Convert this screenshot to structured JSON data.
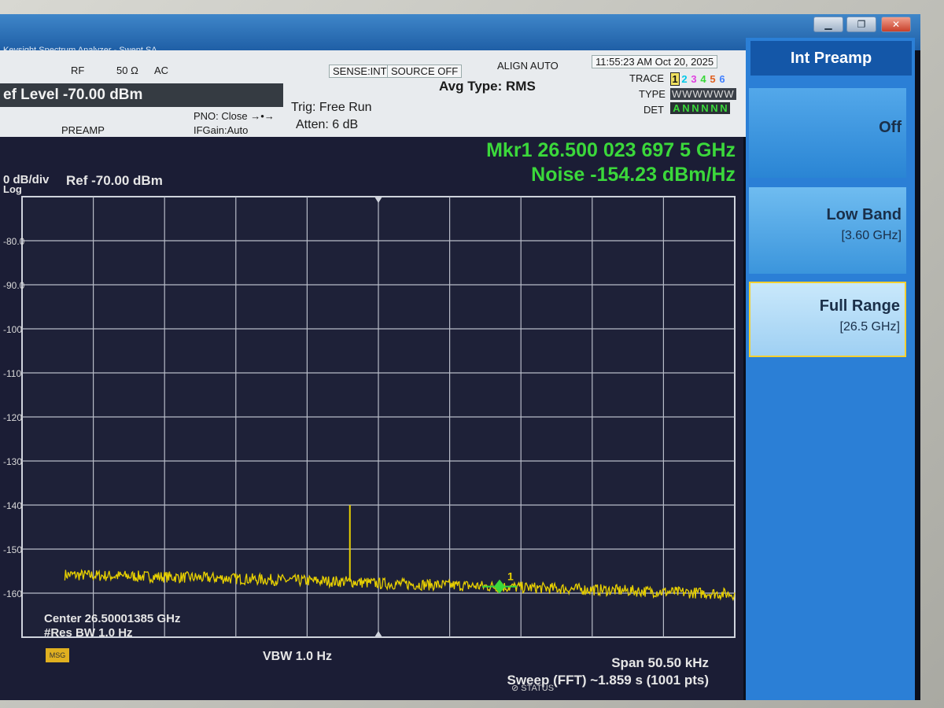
{
  "window": {
    "title": "Keysight Spectrum Analyzer - Swept SA"
  },
  "status": {
    "rf": "RF",
    "impedance": "50 Ω",
    "coupling": "AC",
    "sense": "SENSE:INT",
    "source": "SOURCE OFF",
    "align": "ALIGN AUTO",
    "datetime": "11:55:23 AM Oct 20, 2025",
    "ref_level": "ef Level -70.00 dBm",
    "preamp": "PREAMP",
    "pno": "PNO: Close",
    "ifgain": "IFGain:Auto",
    "trig": "Trig: Free Run",
    "atten": "Atten: 6 dB",
    "avg_type": "Avg Type: RMS",
    "trace_label": "TRACE",
    "type_label": "TYPE",
    "det_label": "DET",
    "trace_nums": [
      "1",
      "2",
      "3",
      "4",
      "5",
      "6"
    ],
    "type_row": "WWWWWW",
    "det_row": [
      "A",
      "N",
      "N",
      "N",
      "N",
      "N"
    ],
    "trace_colors": [
      "#e8d000",
      "#00c8e8",
      "#e040e0",
      "#38d838",
      "#e06020",
      "#4080ff"
    ]
  },
  "marker": {
    "freq": "Mkr1 26.500 023 697 5 GHz",
    "noise": "Noise -154.23 dBm/Hz",
    "label": "1"
  },
  "scale": {
    "per_div": "0 dB/div",
    "log": "Log",
    "ref": "Ref -70.00 dBm"
  },
  "footer": {
    "center": "Center 26.50001385 GHz",
    "rbw": "#Res BW 1.0 Hz",
    "vbw": "VBW 1.0 Hz",
    "span": "Span 50.50 kHz",
    "sweep": "Sweep (FFT)  ~1.859 s (1001 pts)",
    "msg": "MSG",
    "status": "STATUS"
  },
  "menu": {
    "title": "Int Preamp",
    "off": "Off",
    "low_band": "Low Band",
    "low_band_sub": "[3.60 GHz]",
    "full_range": "Full Range",
    "full_range_sub": "[26.5 GHz]"
  },
  "chart_data": {
    "type": "line",
    "ytick_labels": [
      "-80.0",
      "-90.0",
      "-100",
      "-110",
      "-120",
      "-130",
      "-140",
      "-150",
      "-160"
    ],
    "ylim": [
      -170,
      -70
    ],
    "y_divisions": 10,
    "x_divisions": 10,
    "grid": true,
    "trace_color": "#e8d000",
    "series": [
      {
        "x": [
          0,
          0.1,
          0.2,
          0.3,
          0.4,
          0.46,
          0.5,
          0.6,
          0.7,
          0.8,
          0.9,
          1.0
        ],
        "values": [
          -155.5,
          -156.0,
          -156.3,
          -156.7,
          -157.2,
          -157.4,
          -157.8,
          -158.2,
          -158.7,
          -159.2,
          -159.7,
          -160.2
        ]
      }
    ],
    "spike": {
      "x": 0.46,
      "value": -140
    },
    "marker": {
      "x": 0.67,
      "value": -158.5
    }
  }
}
